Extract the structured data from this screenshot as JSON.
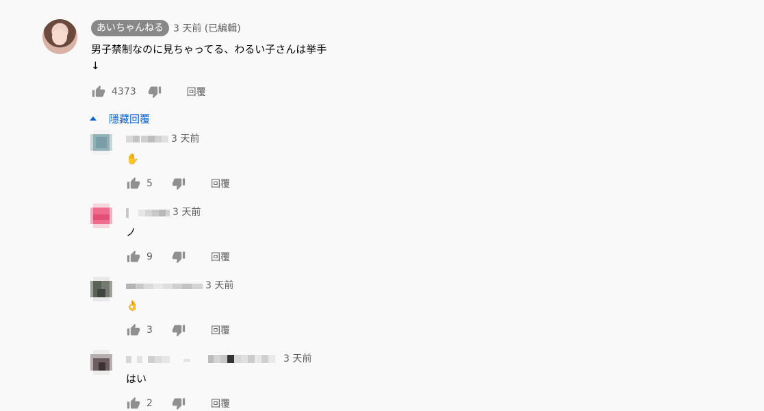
{
  "top_comment": {
    "author": "あいちゃんねる",
    "meta": "3 天前 (已編輯)",
    "text_line1": "男子禁制なのに見ちゃってる、わるい子さんは挙手",
    "text_line2": "↓",
    "likes": "4373",
    "reply_label": "回覆",
    "hide_replies_label": "隱藏回覆"
  },
  "replies": [
    {
      "meta": "3 天前",
      "text": "✋",
      "likes": "5",
      "reply_label": "回覆",
      "avatar_color": "#8fb0b6"
    },
    {
      "meta": "3 天前",
      "text": "ノ",
      "likes": "9",
      "reply_label": "回覆",
      "avatar_color": "#ee6c8e"
    },
    {
      "meta": "3 天前",
      "text": "👌",
      "likes": "3",
      "reply_label": "回覆",
      "avatar_color": "#5a6355"
    },
    {
      "meta": "3 天前",
      "text": "はい",
      "likes": "2",
      "reply_label": "回覆",
      "avatar_color": "#6e5d60"
    }
  ],
  "icons": {
    "like": "thumbs-up-icon",
    "dislike": "thumbs-down-icon",
    "caret": "caret-up-icon"
  },
  "colors": {
    "background": "#f9f9f9",
    "link": "#065fd4",
    "secondary_text": "#606060",
    "icon": "#909090",
    "badge": "#888888"
  }
}
